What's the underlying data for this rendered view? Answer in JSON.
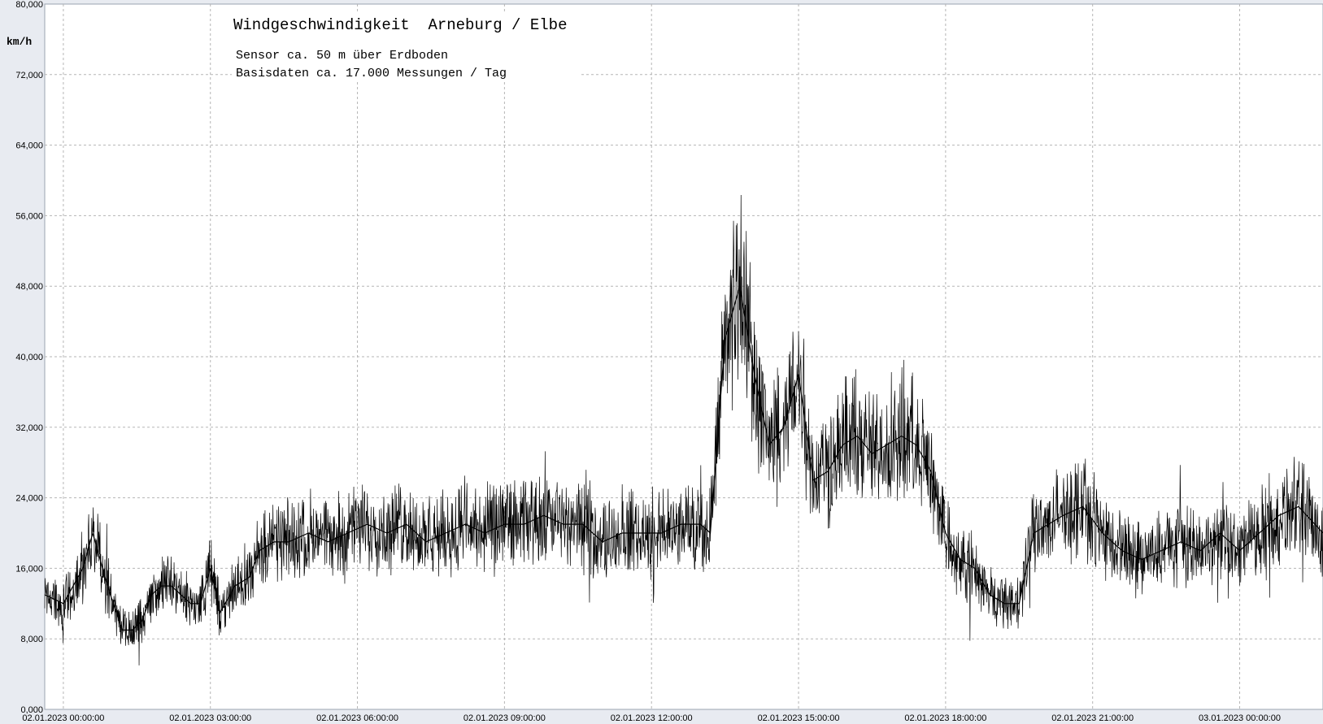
{
  "chart_data": {
    "type": "line",
    "title": "Windgeschwindigkeit  Arneburg / Elbe",
    "subtitle_lines": [
      "Sensor ca. 50 m über Erdboden",
      "Basisdaten ca. 17.000 Messungen / Tag"
    ],
    "ylabel": "km/h",
    "xlabel": "",
    "ylim": [
      0,
      80
    ],
    "y_ticks": [
      0,
      8,
      16,
      24,
      32,
      40,
      48,
      56,
      64,
      72,
      80
    ],
    "y_tick_labels": [
      "0,000",
      "8,000",
      "16,000",
      "24,000",
      "32,000",
      "40,000",
      "48,000",
      "56,000",
      "64,000",
      "72,000",
      "80,000"
    ],
    "x_unit": "hours since 02.01.2023 00:00:00",
    "xlim": [
      -0.38,
      25.7
    ],
    "x_ticks": [
      0,
      3,
      6,
      9,
      12,
      15,
      18,
      21,
      24
    ],
    "x_tick_labels": [
      "02.01.2023  00:00:00",
      "02.01.2023  03:00:00",
      "02.01.2023  06:00:00",
      "02.01.2023  09:00:00",
      "02.01.2023  12:00:00",
      "02.01.2023  15:00:00",
      "02.01.2023  18:00:00",
      "02.01.2023  21:00:00",
      "03.01.2023  00:00:00"
    ],
    "grid": true,
    "series": [
      {
        "color": "#000000",
        "x": [
          -0.38,
          0.0,
          0.2,
          0.4,
          0.6,
          0.9,
          1.2,
          1.4,
          1.6,
          1.8,
          2.0,
          2.2,
          2.4,
          2.6,
          2.8,
          3.0,
          3.2,
          3.5,
          3.8,
          4.0,
          4.3,
          4.6,
          5.0,
          5.4,
          5.8,
          6.2,
          6.6,
          7.0,
          7.4,
          7.8,
          8.2,
          8.6,
          9.0,
          9.4,
          9.8,
          10.2,
          10.6,
          11.0,
          11.4,
          11.8,
          12.2,
          12.6,
          13.0,
          13.2,
          13.5,
          13.8,
          14.1,
          14.4,
          14.7,
          15.0,
          15.3,
          15.6,
          15.9,
          16.2,
          16.5,
          16.8,
          17.1,
          17.4,
          17.7,
          18.0,
          18.3,
          18.6,
          18.9,
          19.2,
          19.5,
          19.8,
          20.1,
          20.4,
          20.8,
          21.2,
          21.6,
          22.0,
          22.4,
          22.8,
          23.2,
          23.6,
          24.0,
          24.4,
          24.8,
          25.2,
          25.7
        ],
        "y": [
          13,
          12,
          14,
          16,
          20,
          14,
          9,
          9,
          10,
          13,
          14,
          14,
          13,
          12,
          12,
          16,
          11,
          14,
          15,
          18,
          19,
          19,
          20,
          19,
          20,
          21,
          20,
          21,
          19,
          20,
          21,
          20,
          21,
          21,
          22,
          21,
          21,
          19,
          20,
          20,
          20,
          21,
          21,
          20,
          42,
          48,
          38,
          30,
          32,
          38,
          26,
          27,
          30,
          31,
          29,
          30,
          31,
          30,
          27,
          20,
          17,
          16,
          13,
          12,
          12,
          20,
          21,
          22,
          23,
          20,
          18,
          17,
          18,
          19,
          18,
          20,
          18,
          20,
          22,
          23,
          20
        ]
      }
    ]
  }
}
